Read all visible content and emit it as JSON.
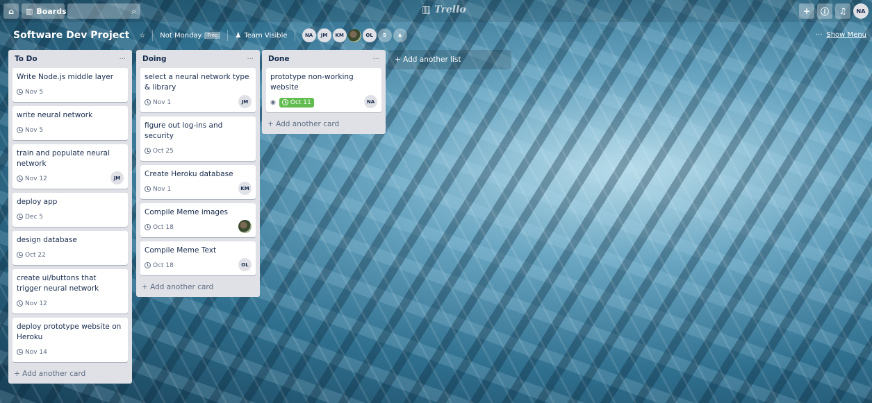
{
  "header": {
    "boards_label": "Boards",
    "logo": "Trello",
    "avatar_initials": "NA",
    "icons": [
      "home-icon",
      "boards-icon",
      "search-icon",
      "plus-icon",
      "info-icon",
      "bell-icon"
    ]
  },
  "board": {
    "title": "Software Dev Project",
    "team": "Not Monday",
    "team_badge": "Free",
    "visibility": "Team Visible",
    "members": [
      "NA",
      "JM",
      "KM",
      "",
      "OL"
    ],
    "members_extra": "5",
    "show_menu": "Show Menu",
    "show_menu_prefix": "···"
  },
  "lists": [
    {
      "title": "To Do",
      "menu": "···",
      "add_card": "+ Add another card",
      "cards": [
        {
          "title": "Write Node.js middle layer",
          "due": "Nov 5"
        },
        {
          "title": "write neural network",
          "due": "Nov 5"
        },
        {
          "title": "train and populate neural network",
          "due": "Nov 12",
          "member": "JM"
        },
        {
          "title": "deploy app",
          "due": "Dec 5"
        },
        {
          "title": "design database",
          "due": "Oct 22"
        },
        {
          "title": "create ui/buttons that trigger neural network",
          "due": "Nov 12"
        },
        {
          "title": "deploy prototype website on Heroku",
          "due": "Nov 14"
        }
      ]
    },
    {
      "title": "Doing",
      "menu": "···",
      "add_card": "+ Add another card",
      "cards": [
        {
          "title": "select a neural network type & library",
          "due": "Nov 1",
          "member": "JM"
        },
        {
          "title": "figure out log-ins and security",
          "due": "Oct 25"
        },
        {
          "title": "Create Heroku database",
          "due": "Nov 1",
          "member": "KM"
        },
        {
          "title": "Compile Meme images",
          "due": "Oct 18",
          "member": "photo"
        },
        {
          "title": "Compile Meme Text",
          "due": "Oct 18",
          "member": "OL"
        }
      ]
    },
    {
      "title": "Done",
      "menu": "···",
      "add_card": "+ Add another card",
      "cards": [
        {
          "title": "prototype non-working website",
          "due": "Oct 11",
          "member": "NA",
          "complete": true
        }
      ]
    }
  ],
  "add_list": "+ Add another list",
  "colors": {
    "due_complete": "#61bd4f",
    "list_bg": "#dfe1e6",
    "text": "#172b4d"
  }
}
